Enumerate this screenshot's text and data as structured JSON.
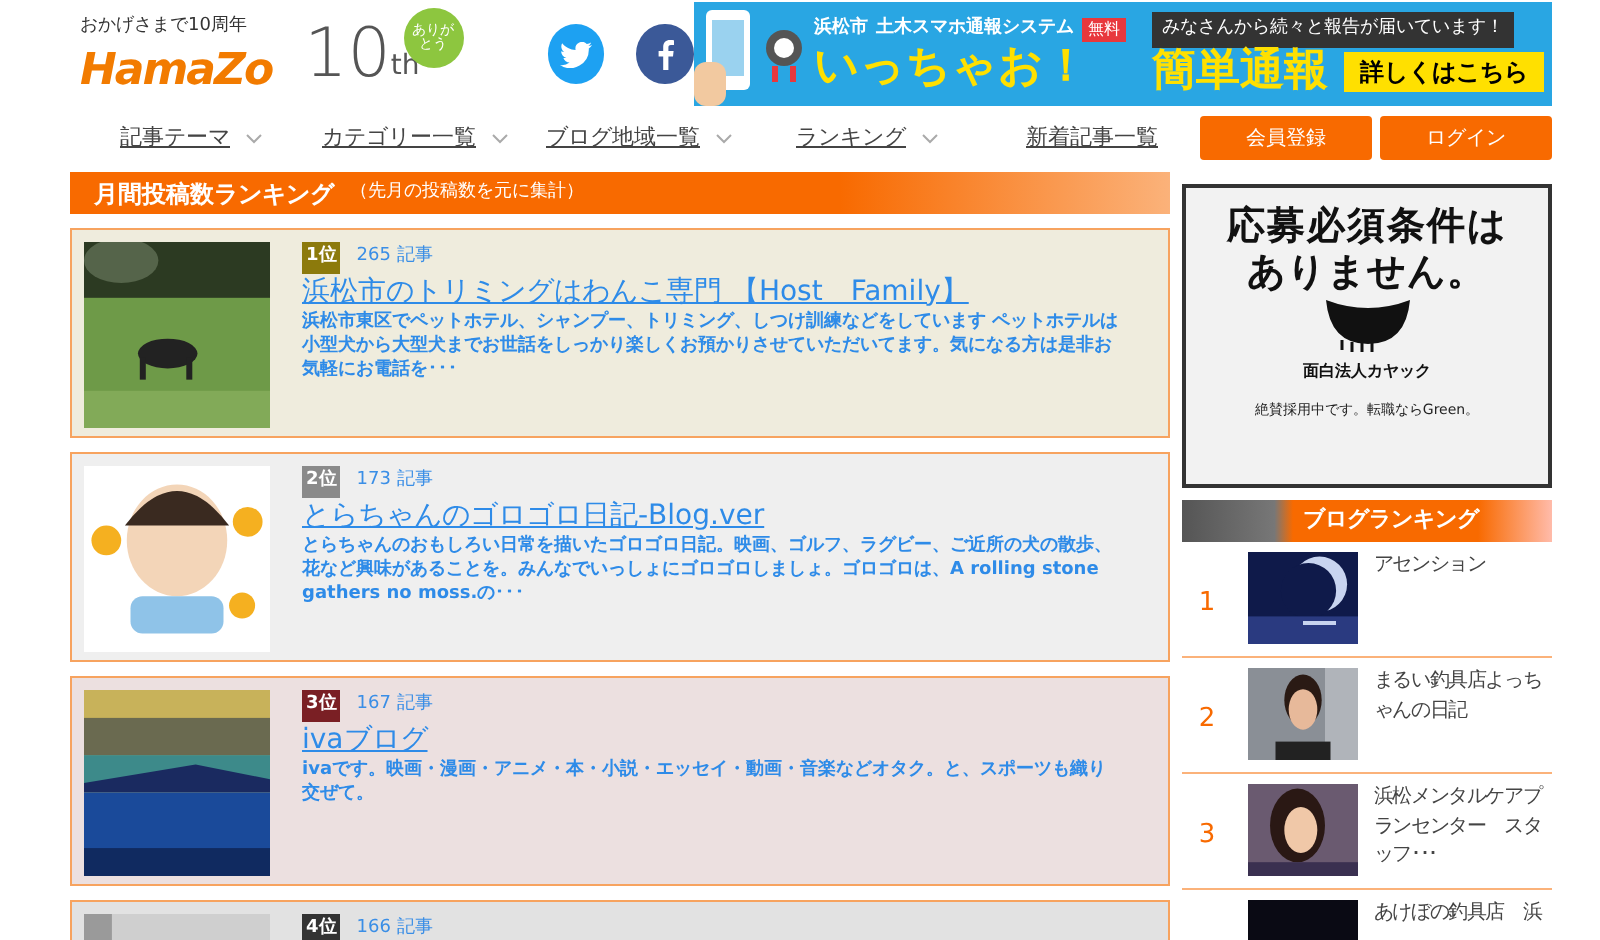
{
  "logo": {
    "tagline": "おかげさまで10周年",
    "name": "HamaZo",
    "anniversary": "10",
    "suffix": "th",
    "badge": "ありがとう"
  },
  "social": [
    {
      "kind": "twitter"
    },
    {
      "kind": "facebook"
    }
  ],
  "banner": {
    "city": "浜松市",
    "system": "土木スマホ通報システム",
    "free": "無料",
    "slogan": "いっちゃお！",
    "message": "みなさんから続々と報告が届いています！",
    "headline": "簡単通報",
    "cta": "詳しくはこちら"
  },
  "nav": [
    {
      "label": "記事テーマ",
      "dropdown": true
    },
    {
      "label": "カテゴリー一覧",
      "dropdown": true
    },
    {
      "label": "ブログ地域一覧",
      "dropdown": true
    },
    {
      "label": "ランキング",
      "dropdown": true
    },
    {
      "label": "新着記事一覧",
      "dropdown": false
    }
  ],
  "auth_buttons": [
    "会員登録",
    "ログイン"
  ],
  "ranking": {
    "title": "月間投稿数ランキング",
    "subtitle": "（先月の投稿数を元に集計）",
    "entries": [
      {
        "rank": "1位",
        "color": "#8c7a0c",
        "posts": "265 記事",
        "title": "浜松市のトリミングはわんこ専門 【Host　Family】",
        "description": "浜松市東区でペットホテル、シャンプー、トリミング、しつけ訓練などをしています ペットホテルは小型犬から大型犬までお世話をしっかり楽しくお預かりさせていただいてます。気になる方は是非お気軽にお電話を･･･"
      },
      {
        "rank": "2位",
        "color": "#8a8a8a",
        "posts": "173 記事",
        "title": "とらちゃんのゴロゴロ日記-Blog.ver",
        "description": "とらちゃんのおもしろい日常を描いたゴロゴロ日記。映画、ゴルフ、ラグビー、ご近所の犬の散歩、花など興味があることを。みんなでいっしょにゴロゴロしましょ。ゴロゴロは、A rolling stone gathers no moss.の･･･"
      },
      {
        "rank": "3位",
        "color": "#7a1f24",
        "posts": "167 記事",
        "title": "ivaブログ",
        "description": "ivaです。映画・漫画・アニメ・本・小説・エッセイ・動画・音楽などオタク。と、スポーツも織り交ぜて。"
      },
      {
        "rank": "4位",
        "color": "#333333",
        "posts": "166 記事"
      }
    ]
  },
  "ad": {
    "headline": "応募必須条件はありません。",
    "company": "面白法人カヤック",
    "footer": "絶賛採用中です。転職ならGreen。"
  },
  "blog_ranking": {
    "title": "ブログランキング",
    "items": [
      {
        "rank": "1",
        "name": "アセンション"
      },
      {
        "rank": "2",
        "name": "まるい釣具店よっちゃんの日記"
      },
      {
        "rank": "3",
        "name": "浜松メンタルケアプランセンター　スタッフ･･･"
      },
      {
        "name": "あけぼの釣具店　浜"
      }
    ]
  }
}
